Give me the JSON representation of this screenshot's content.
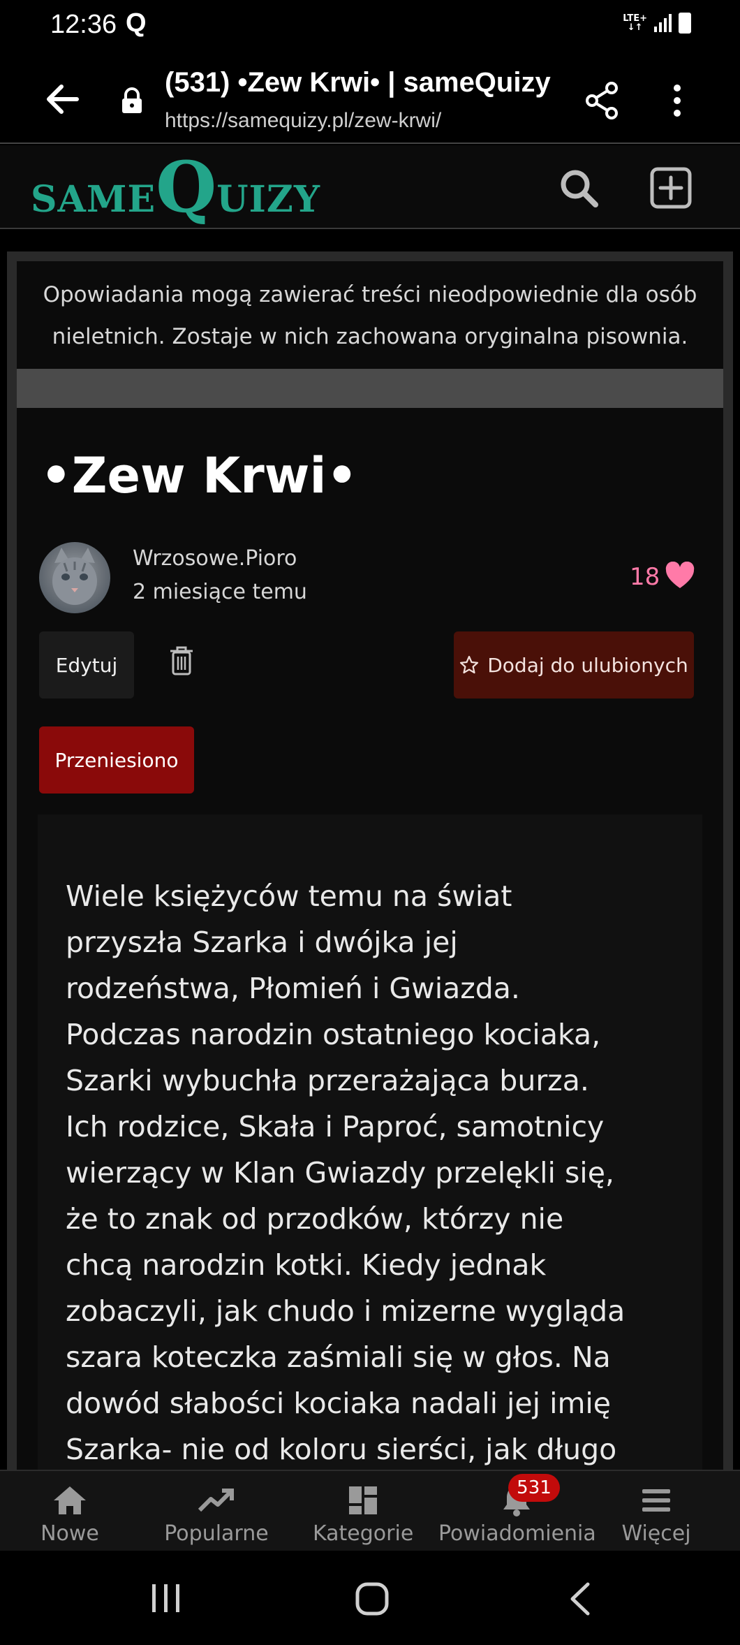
{
  "status_bar": {
    "time": "12:36",
    "notification_glyph": "Q",
    "network": "LTE+",
    "network_sub": "↓↑"
  },
  "browser": {
    "title": "(531) •Zew Krwi• | sameQuizy",
    "url": "https://samequizy.pl/zew-krwi/"
  },
  "site": {
    "logo_same": "SAME",
    "logo_q": "Q",
    "logo_rest": "UIZY",
    "accent": "#23a58a"
  },
  "warning": "Opowiadania mogą zawierać treści nieodpowiednie dla osób nieletnich. Zostaje w nich zachowana oryginalna pisownia.",
  "story": {
    "title": "•Zew Krwi•",
    "author": "Wrzosowe.Pioro",
    "time_ago": "2 miesiące temu",
    "likes": "18",
    "edit_label": "Edytuj",
    "favorite_label": "Dodaj do ulubionych",
    "moved_label": "Przeniesiono",
    "text": "Wiele księżyców temu na świat przyszła Szarka i dwójka jej rodzeństwa, Płomień i Gwiazda. Podczas narodzin ostatniego kociaka, Szarki wybuchła przerażająca burza. Ich rodzice, Skała i Paproć, samotnicy wierzący w Klan Gwiazdy przelękli się, że to znak od przodków, którzy nie chcą narodzin kotki. Kiedy jednak zobaczyli, jak chudo i mizerne wygląda szara koteczka zaśmiali się w głos. Na dowód słabości kociaka nadali jej imię Szarka- nie od koloru sierści, jak długo"
  },
  "nav": {
    "items": [
      {
        "label": "Nowe",
        "icon": "home-icon"
      },
      {
        "label": "Popularne",
        "icon": "trending-icon"
      },
      {
        "label": "Kategorie",
        "icon": "categories-icon"
      },
      {
        "label": "Powiadomienia",
        "icon": "bell-icon"
      },
      {
        "label": "Więcej",
        "icon": "menu-icon"
      }
    ],
    "notification_count": "531"
  }
}
